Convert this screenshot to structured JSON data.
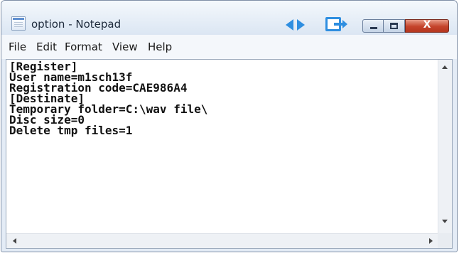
{
  "window": {
    "title": "option - Notepad",
    "icon": "notepad-icon",
    "controls": [
      "back-arrow-icon",
      "forward-arrow-icon",
      "switch-window-icon",
      "minimize-icon",
      "maximize-icon",
      "close-icon"
    ],
    "close_glyph": "X"
  },
  "menu": {
    "items": [
      "File",
      "Edit",
      "Format",
      "View",
      "Help"
    ]
  },
  "editor": {
    "text": "[Register]\nUser name=m1sch13f\nRegistration code=CAE986A4\n[Destinate]\nTemporary folder=C:\\wav file\\\nDisc size=0\nDelete tmp files=1"
  },
  "colors": {
    "accent_blue": "#2e8ee0",
    "close_red": "#c4432b",
    "frame": "#e4ecf6"
  }
}
